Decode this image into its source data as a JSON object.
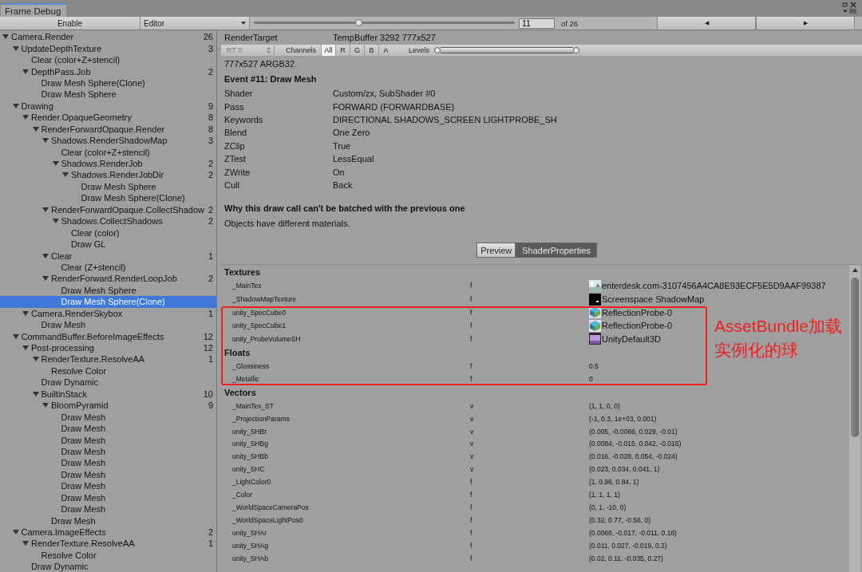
{
  "window": {
    "title": "Frame Debug"
  },
  "toolbar": {
    "enable": "Enable",
    "mode": "Editor",
    "event_slider": {
      "level": 0.4
    },
    "event_field": "11",
    "event_of": "of 26",
    "prev": "◀",
    "next": "▶"
  },
  "tree": [
    {
      "label": "Camera.Render",
      "count": "26",
      "expanded": true,
      "selected": false,
      "children": [
        {
          "label": "UpdateDepthTexture",
          "count": "3",
          "expanded": true,
          "selected": false,
          "children": [
            {
              "label": "Clear (color+Z+stencil)",
              "selected": false
            },
            {
              "label": "DepthPass.Job",
              "count": "2",
              "expanded": true,
              "selected": false,
              "children": [
                {
                  "label": "Draw Mesh Sphere(Clone)",
                  "selected": false
                },
                {
                  "label": "Draw Mesh Sphere",
                  "selected": false
                }
              ]
            }
          ]
        },
        {
          "label": "Drawing",
          "count": "9",
          "expanded": true,
          "selected": false,
          "children": [
            {
              "label": "Render.OpaqueGeometry",
              "count": "8",
              "expanded": true,
              "selected": false,
              "children": [
                {
                  "label": "RenderForwardOpaque.Render",
                  "count": "8",
                  "expanded": true,
                  "selected": false,
                  "children": [
                    {
                      "label": "Shadows.RenderShadowMap",
                      "count": "3",
                      "expanded": true,
                      "selected": false,
                      "children": [
                        {
                          "label": "Clear (color+Z+stencil)",
                          "selected": false
                        },
                        {
                          "label": "Shadows.RenderJob",
                          "count": "2",
                          "expanded": true,
                          "selected": false,
                          "children": [
                            {
                              "label": "Shadows.RenderJobDir",
                              "count": "2",
                              "expanded": true,
                              "selected": false,
                              "children": [
                                {
                                  "label": "Draw Mesh Sphere",
                                  "selected": false
                                },
                                {
                                  "label": "Draw Mesh Sphere(Clone)",
                                  "selected": false
                                }
                              ]
                            }
                          ]
                        }
                      ]
                    },
                    {
                      "label": "RenderForwardOpaque.CollectShadow",
                      "count": "2",
                      "expanded": true,
                      "selected": false,
                      "children": [
                        {
                          "label": "Shadows.CollectShadows",
                          "count": "2",
                          "expanded": true,
                          "selected": false,
                          "children": [
                            {
                              "label": "Clear (color)",
                              "selected": false
                            },
                            {
                              "label": "Draw GL",
                              "selected": false
                            }
                          ]
                        }
                      ]
                    },
                    {
                      "label": "Clear",
                      "count": "1",
                      "expanded": true,
                      "selected": false,
                      "children": [
                        {
                          "label": "Clear (Z+stencil)",
                          "selected": false
                        }
                      ]
                    },
                    {
                      "label": "RenderForward.RenderLoopJob",
                      "count": "2",
                      "expanded": true,
                      "selected": false,
                      "children": [
                        {
                          "label": "Draw Mesh Sphere",
                          "selected": false
                        },
                        {
                          "label": "Draw Mesh Sphere(Clone)",
                          "selected": true
                        }
                      ]
                    }
                  ]
                }
              ]
            },
            {
              "label": "Camera.RenderSkybox",
              "count": "1",
              "expanded": true,
              "selected": false,
              "children": [
                {
                  "label": "Draw Mesh",
                  "selected": false
                }
              ]
            }
          ]
        },
        {
          "label": "CommandBuffer.BeforeImageEffects",
          "count": "12",
          "expanded": true,
          "selected": false,
          "children": [
            {
              "label": "Post-processing",
              "count": "12",
              "expanded": true,
              "selected": false,
              "children": [
                {
                  "label": "RenderTexture.ResolveAA",
                  "count": "1",
                  "expanded": true,
                  "selected": false,
                  "children": [
                    {
                      "label": "Resolve Color",
                      "selected": false
                    }
                  ]
                },
                {
                  "label": "Draw Dynamic",
                  "selected": false
                },
                {
                  "label": "BuiltinStack",
                  "count": "10",
                  "expanded": true,
                  "selected": false,
                  "children": [
                    {
                      "label": "BloomPyramid",
                      "count": "9",
                      "expanded": true,
                      "selected": false,
                      "children": [
                        {
                          "label": "Draw Mesh",
                          "selected": false
                        },
                        {
                          "label": "Draw Mesh",
                          "selected": false
                        },
                        {
                          "label": "Draw Mesh",
                          "selected": false
                        },
                        {
                          "label": "Draw Mesh",
                          "selected": false
                        },
                        {
                          "label": "Draw Mesh",
                          "selected": false
                        },
                        {
                          "label": "Draw Mesh",
                          "selected": false
                        },
                        {
                          "label": "Draw Mesh",
                          "selected": false
                        },
                        {
                          "label": "Draw Mesh",
                          "selected": false
                        },
                        {
                          "label": "Draw Mesh",
                          "selected": false
                        }
                      ]
                    },
                    {
                      "label": "Draw Mesh",
                      "selected": false
                    }
                  ]
                }
              ]
            }
          ]
        },
        {
          "label": "Camera.ImageEffects",
          "count": "2",
          "expanded": true,
          "selected": false,
          "children": [
            {
              "label": "RenderTexture.ResolveAA",
              "count": "1",
              "expanded": true,
              "selected": false,
              "children": [
                {
                  "label": "Resolve Color",
                  "selected": false
                }
              ]
            },
            {
              "label": "Draw Dynamic",
              "selected": false
            }
          ]
        }
      ]
    }
  ],
  "details": {
    "render_target_label": "RenderTarget",
    "render_target": "TempBuffer 3292 777x527",
    "rt_select": "RT 0",
    "channels_label": "Channels",
    "channels": [
      {
        "label": "All",
        "selected": true
      },
      {
        "label": "R",
        "selected": false
      },
      {
        "label": "G",
        "selected": false
      },
      {
        "label": "B",
        "selected": false
      },
      {
        "label": "A",
        "selected": false
      }
    ],
    "levels_label": "Levels",
    "levels_range": {
      "level": 1
    },
    "format": "777x527 ARGB32",
    "event_title": "Event #11: Draw Mesh",
    "props": [
      {
        "label": "Shader",
        "value": "Custom/zx, SubShader #0"
      },
      {
        "label": "Pass",
        "value": "FORWARD (FORWARDBASE)"
      },
      {
        "label": "Keywords",
        "value": "DIRECTIONAL SHADOWS_SCREEN LIGHTPROBE_SH"
      },
      {
        "label": "Blend",
        "value": "One Zero"
      },
      {
        "label": "ZClip",
        "value": "True"
      },
      {
        "label": "ZTest",
        "value": "LessEqual"
      },
      {
        "label": "ZWrite",
        "value": "On"
      },
      {
        "label": "Cull",
        "value": "Back"
      }
    ],
    "batch_heading": "Why this draw call can't be batched with the previous one",
    "batch_reason": "Objects have different materials.",
    "view_tabs": [
      {
        "label": "Preview",
        "selected": false
      },
      {
        "label": "ShaderProperties",
        "selected": true
      }
    ],
    "sections": [
      {
        "title": "Textures",
        "rows": [
          {
            "name": "_MainTex",
            "type": "f",
            "value": "enterdesk.com-3107456A4CA8E93ECF5E5D9AAF99387",
            "kind": "photo"
          },
          {
            "name": "_ShadowMapTexture",
            "type": "f",
            "value": "Screenspace ShadowMap",
            "kind": "black"
          },
          {
            "name": "unity_SpecCube0",
            "type": "f",
            "value": "ReflectionProbe-0",
            "kind": "cube"
          },
          {
            "name": "unity_SpecCube1",
            "type": "f",
            "value": "ReflectionProbe-0",
            "kind": "cube"
          },
          {
            "name": "unity_ProbeVolumeSH",
            "type": "f",
            "value": "UnityDefault3D",
            "kind": "volume"
          }
        ]
      },
      {
        "title": "Floats",
        "rows": [
          {
            "name": "_Glossiness",
            "type": "f",
            "value": "0.5"
          },
          {
            "name": "_Metallic",
            "type": "f",
            "value": "0"
          }
        ]
      },
      {
        "title": "Vectors",
        "rows": [
          {
            "name": "_MainTex_ST",
            "type": "v",
            "value": "(1, 1, 0, 0)"
          },
          {
            "name": "_ProjectionParams",
            "type": "v",
            "value": "(-1, 0.3, 1e+03, 0.001)"
          },
          {
            "name": "unity_SHBr",
            "type": "v",
            "value": "(0.005, -0.0086, 0.029, -0.01)"
          },
          {
            "name": "unity_SHBg",
            "type": "v",
            "value": "(0.0084, -0.015, 0.042, -0.016)"
          },
          {
            "name": "unity_SHBb",
            "type": "v",
            "value": "(0.016, -0.028, 0.054, -0.024)"
          },
          {
            "name": "unity_SHC",
            "type": "v",
            "value": "(0.023, 0.034, 0.041, 1)"
          },
          {
            "name": "_LightColor0",
            "type": "f",
            "value": "(1, 0.96, 0.84, 1)"
          },
          {
            "name": "_Color",
            "type": "f",
            "value": "(1, 1, 1, 1)"
          },
          {
            "name": "_WorldSpaceCameraPos",
            "type": "f",
            "value": "(0, 1, -10, 0)"
          },
          {
            "name": "_WorldSpaceLightPos0",
            "type": "f",
            "value": "(0.32, 0.77, -0.56, 0)"
          },
          {
            "name": "unity_SHAr",
            "type": "f",
            "value": "(0.0066, -0.017, -0.011, 0.16)"
          },
          {
            "name": "unity_SHAg",
            "type": "f",
            "value": "(0.011, 0.027, -0.019, 0.2)"
          },
          {
            "name": "unity_SHAb",
            "type": "f",
            "value": "(0.02, 0.11, -0.035, 0.27)"
          }
        ]
      }
    ]
  },
  "annotation": {
    "text": "AssetBundle加载实例化的球"
  }
}
